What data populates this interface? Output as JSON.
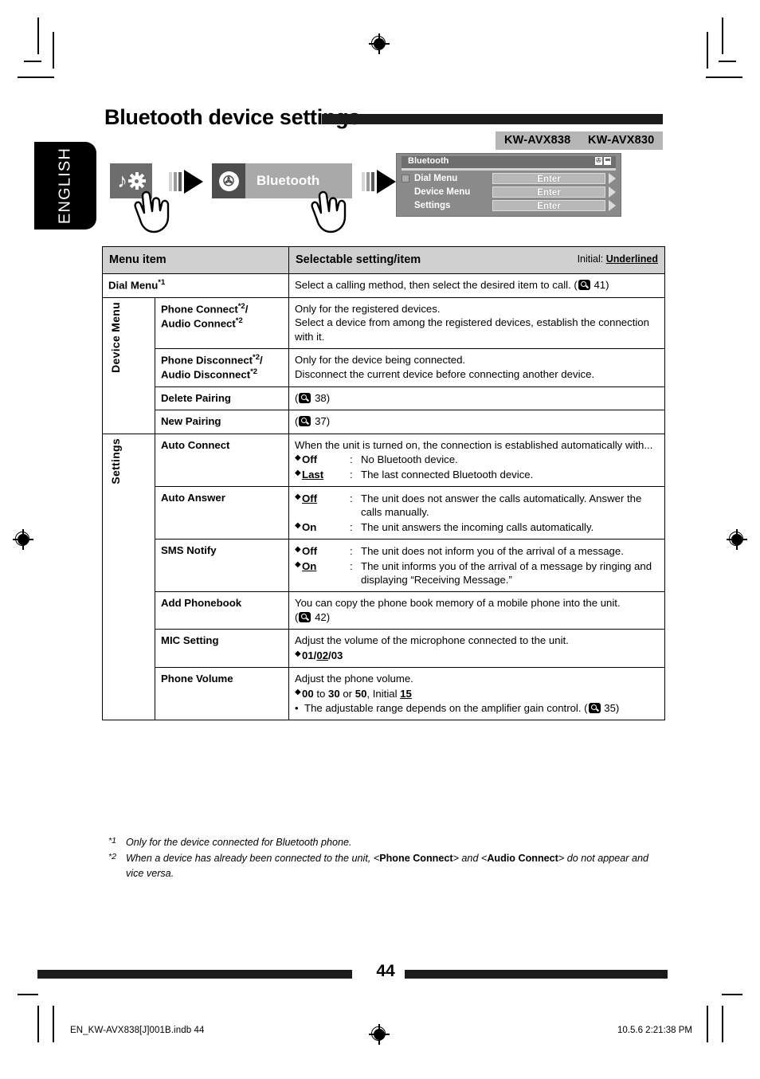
{
  "page": {
    "title": "Bluetooth device settings",
    "language_tab": "ENGLISH",
    "number": "44",
    "imprint_left": "EN_KW-AVX838[J]001B.indb   44",
    "imprint_right": "10.5.6   2:21:38 PM"
  },
  "badges": {
    "model_1": "KW-AVX838",
    "model_2": "KW-AVX830"
  },
  "flow": {
    "menu_button_icon": "music-note-gear-icon",
    "bluetooth_button_label": "Bluetooth",
    "bluetooth_icon": "bluetooth-icon"
  },
  "device_screen": {
    "title": "Bluetooth",
    "status_icons": [
      "bluetooth-icon",
      "phone-icon"
    ],
    "rows": [
      {
        "label": "Dial Menu",
        "action": "Enter"
      },
      {
        "label": "Device Menu",
        "action": "Enter"
      },
      {
        "label": "Settings",
        "action": "Enter"
      }
    ]
  },
  "table": {
    "header": {
      "col1": "Menu item",
      "col2": "Selectable setting/item",
      "initial_prefix": "Initial: ",
      "initial_value": "Underlined"
    },
    "dial_menu": {
      "name": "Dial Menu",
      "footnote": "*1",
      "desc": "Select a calling method, then select the desired item to call. (",
      "page_ref": "41",
      "desc_end": ")"
    },
    "group_device_menu": "Device Menu",
    "group_settings": "Settings",
    "rows": {
      "phone_connect": {
        "name_line1": "Phone Connect",
        "name_line1_sup": "*2",
        "name_line1_tail": "/",
        "name_line2": "Audio Connect",
        "name_line2_sup": "*2",
        "desc_line1": "Only for the registered devices.",
        "desc_line2": "Select a device from among the registered devices, establish the connection with it."
      },
      "phone_disconnect": {
        "name_line1": "Phone Disconnect",
        "name_line1_sup": "*2",
        "name_line1_tail": "/",
        "name_line2": "Audio Disconnect",
        "name_line2_sup": "*2",
        "desc_line1": "Only for the device being connected.",
        "desc_line2": "Disconnect the current device before connecting another device."
      },
      "delete_pairing": {
        "name": "Delete Pairing",
        "page_ref": "38"
      },
      "new_pairing": {
        "name": "New Pairing",
        "page_ref": "37"
      },
      "auto_connect": {
        "name": "Auto Connect",
        "intro": "When the unit is turned on, the connection is established automatically with...",
        "options": [
          {
            "key": "Off",
            "underlined": false,
            "colon": ":",
            "desc": "No Bluetooth device."
          },
          {
            "key": "Last",
            "underlined": true,
            "colon": ":",
            "desc": "The last connected Bluetooth device."
          }
        ]
      },
      "auto_answer": {
        "name": "Auto Answer",
        "options": [
          {
            "key": "Off",
            "underlined": true,
            "colon": ":",
            "desc": "The unit does not answer the calls automatically. Answer the calls manually."
          },
          {
            "key": "On",
            "underlined": false,
            "colon": ":",
            "desc": "The unit answers the incoming calls automatically."
          }
        ]
      },
      "sms_notify": {
        "name": "SMS Notify",
        "options": [
          {
            "key": "Off",
            "underlined": false,
            "colon": ":",
            "desc": "The unit does not inform you of the arrival of a message."
          },
          {
            "key": "On",
            "underlined": true,
            "colon": ":",
            "desc": "The unit informs you of the arrival of a message by ringing and displaying “Receiving Message.”"
          }
        ]
      },
      "add_phonebook": {
        "name": "Add Phonebook",
        "desc": "You can copy the phone book memory of a mobile phone into the unit.",
        "page_ref": "42"
      },
      "mic_setting": {
        "name": "MIC Setting",
        "desc": "Adjust the volume of the microphone connected to the unit.",
        "values_prefix": "01/",
        "values_initial": "02",
        "values_suffix": "/03"
      },
      "phone_volume": {
        "name": "Phone Volume",
        "desc": "Adjust the phone volume.",
        "range_a": "00",
        "range_mid": " to ",
        "range_b": "30",
        "range_or": " or ",
        "range_c": "50",
        "range_initial_label": ", Initial ",
        "range_initial": "15",
        "note": "The adjustable range depends on the amplifier gain control. (",
        "note_page_ref": "35",
        "note_end": ")"
      }
    }
  },
  "footnotes": [
    {
      "mark": "*1",
      "text": "Only for the device connected for Bluetooth phone."
    },
    {
      "mark": "*2",
      "pre": "When a device has already been connected to the unit, <",
      "b1": "Phone Connect",
      "mid": "> and <",
      "b2": "Audio Connect",
      "post": "> do not appear and vice versa."
    }
  ],
  "colors": {
    "rule": "#1c1c1c",
    "badge_bg": "#b6b6b6",
    "header_bg": "#d0d0d0",
    "device_bg": "#8a8a8a"
  }
}
